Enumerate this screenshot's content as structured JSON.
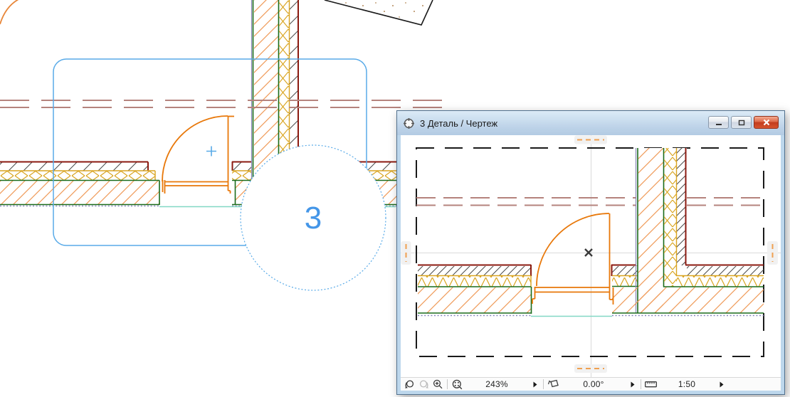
{
  "window": {
    "title": "3 Деталь / Чертеж",
    "toolbar": {
      "zoom_value": "243%",
      "rotation_value": "0.00°",
      "scale_value": "1:50"
    }
  },
  "drawing": {
    "detail_marker_label": "3"
  },
  "icons": {
    "detail_window_icon": "circle-with-cross detail marker",
    "minimize_icon": "underscore bar",
    "maximize_icon": "square outline",
    "close_icon": "white x",
    "zoom_previous_icon": "magnifier with back arrow",
    "zoom_next_icon": "magnifier with forward arrow (disabled)",
    "zoom_in_icon": "magnifier with plus",
    "fit_in_window_icon": "magnifier with four dots",
    "rotation_icon": "tilted rectangle with arrow",
    "scale_icon": "ruler",
    "flyout_arrow_icon": "small right triangle"
  },
  "colors": {
    "marker_blue": "#4496e8",
    "boundary_blue": "#58aae8",
    "door_orange": "#e8780a",
    "hatch_orange": "#ef9a58",
    "insulation_yellow": "#d9a420",
    "wall_green": "#1a6b1a",
    "wall_dark_red": "#8b1a10",
    "axis_dashed_red": "#b5837d",
    "slab_teal": "#82d8c4",
    "membrane_purple": "#8585bd",
    "handle_orange": "#f0a050",
    "titlebar_blue": "#bcd2e8",
    "close_red": "#c23c1e"
  }
}
